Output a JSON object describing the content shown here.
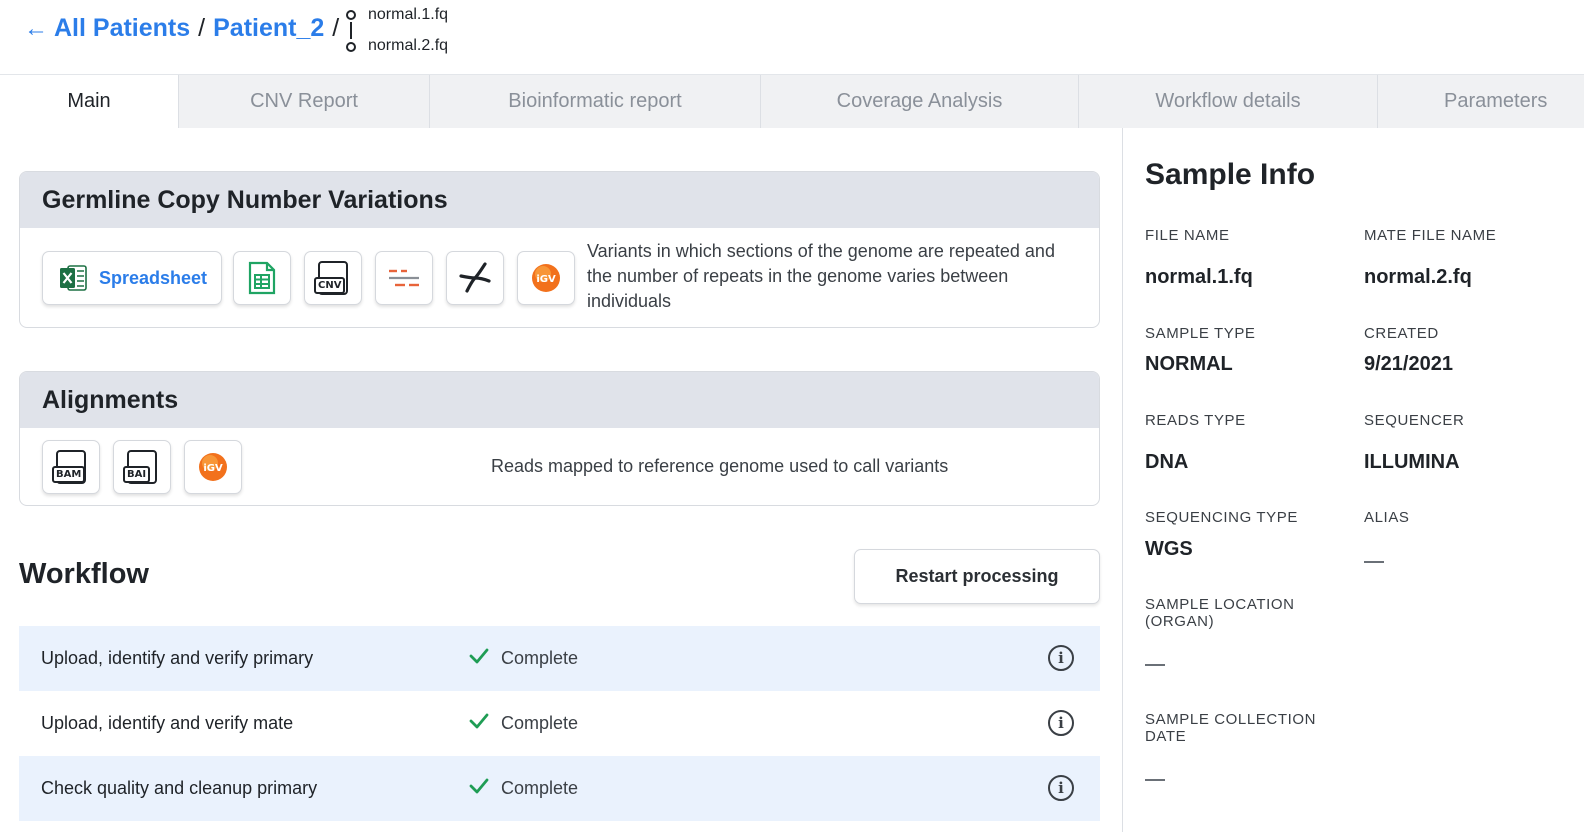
{
  "breadcrumb": {
    "back_arrow": "←",
    "all_patients": "All Patients",
    "separator": "/",
    "patient": "Patient_2",
    "file_primary": "normal.1.fq",
    "file_mate": "normal.2.fq"
  },
  "tabs": [
    {
      "label": "Main",
      "active": true
    },
    {
      "label": "CNV Report",
      "active": false
    },
    {
      "label": "Bioinformatic report",
      "active": false
    },
    {
      "label": "Coverage Analysis",
      "active": false
    },
    {
      "label": "Workflow details",
      "active": false
    },
    {
      "label": "Parameters",
      "active": false
    }
  ],
  "cnv_card": {
    "title": "Germline Copy Number Variations",
    "spreadsheet_label": "Spreadsheet",
    "cnv_icon_tag": "CNV",
    "igv_icon_tag": "iGV",
    "description": "Variants in which sections of the genome are repeated and the number of repeats in the genome varies between individuals",
    "icons": [
      "excel-icon",
      "google-sheets-icon",
      "cnv-file-icon",
      "segments-icon",
      "chromosome-icon",
      "igv-icon"
    ]
  },
  "alignments_card": {
    "title": "Alignments",
    "bam_tag": "BAM",
    "bai_tag": "BAI",
    "igv_icon_tag": "iGV",
    "description": "Reads mapped to reference genome used to call variants",
    "icons": [
      "bam-file-icon",
      "bai-file-icon",
      "igv-icon"
    ]
  },
  "workflow": {
    "title": "Workflow",
    "restart_label": "Restart processing",
    "info_glyph": "i",
    "steps": [
      {
        "name": "Upload, identify and verify primary",
        "status": "Complete"
      },
      {
        "name": "Upload, identify and verify mate",
        "status": "Complete"
      },
      {
        "name": "Check quality and cleanup primary",
        "status": "Complete"
      }
    ]
  },
  "sample_info": {
    "title": "Sample Info",
    "file_name_label": "FILE NAME",
    "file_name": "normal.1.fq",
    "mate_file_name_label": "MATE FILE NAME",
    "mate_file_name": "normal.2.fq",
    "sample_type_label": "SAMPLE TYPE",
    "sample_type": "NORMAL",
    "created_label": "CREATED",
    "created": "9/21/2021",
    "reads_type_label": "READS TYPE",
    "reads_type": "DNA",
    "sequencer_label": "SEQUENCER",
    "sequencer": "ILLUMINA",
    "sequencing_type_label": "SEQUENCING TYPE",
    "sequencing_type": "WGS",
    "alias_label": "ALIAS",
    "sample_location_label": "SAMPLE LOCATION (ORGAN)",
    "sample_collection_date_label": "SAMPLE COLLECTION DATE"
  },
  "colors": {
    "link": "#2b7de9",
    "card_header": "#e0e3ea",
    "row_shade": "#eaf2fd",
    "check_green": "#1f9d55",
    "excel_green": "#1d7044",
    "sheets_green": "#1fa463",
    "igv_orange": "#f2711c"
  }
}
